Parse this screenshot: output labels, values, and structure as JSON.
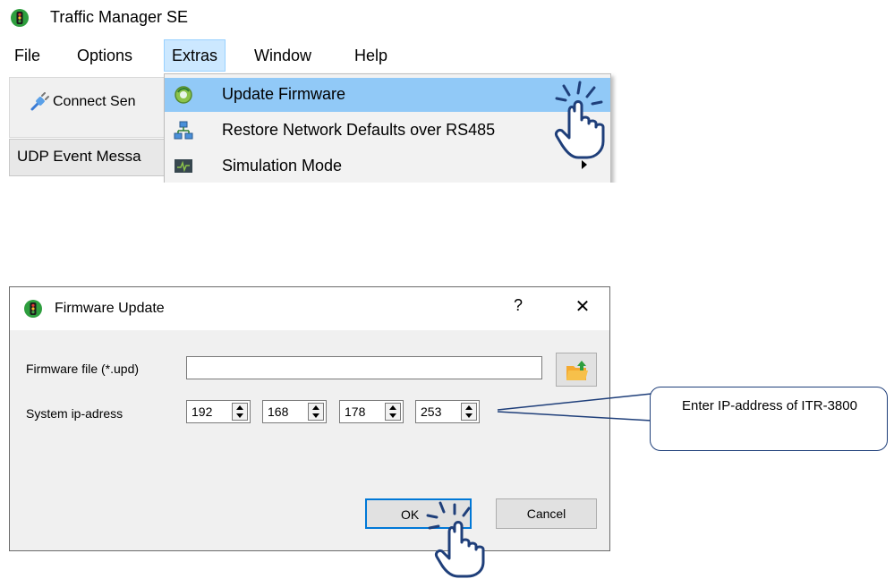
{
  "app": {
    "title": "Traffic Manager SE",
    "menu": [
      "File",
      "Options",
      "Extras",
      "Window",
      "Help"
    ],
    "toolbar_button": "Connect Sen",
    "panel_tab": "UDP Event Messa",
    "extras_menu": [
      {
        "label": "Update Firmware",
        "icon": "gear-refresh-icon",
        "highlighted": true
      },
      {
        "label": "Restore Network Defaults over RS485",
        "icon": "network-icon"
      },
      {
        "label": "Simulation Mode",
        "icon": "monitor-icon",
        "submenu": true
      }
    ]
  },
  "dialog": {
    "title": "Firmware Update",
    "help": "?",
    "close": "✕",
    "firmware_label": "Firmware file (*.upd)",
    "firmware_value": "",
    "ip_label": "System ip-adress",
    "ip_octets": [
      "192",
      "168",
      "178",
      "253"
    ],
    "ok": "OK",
    "cancel": "Cancel"
  },
  "callout": {
    "text": "Enter IP-address of ITR-3800"
  },
  "colors": {
    "menu_highlight": "#91c9f7",
    "focus_border": "#0078d7",
    "callout_border": "#1f3f7a"
  }
}
